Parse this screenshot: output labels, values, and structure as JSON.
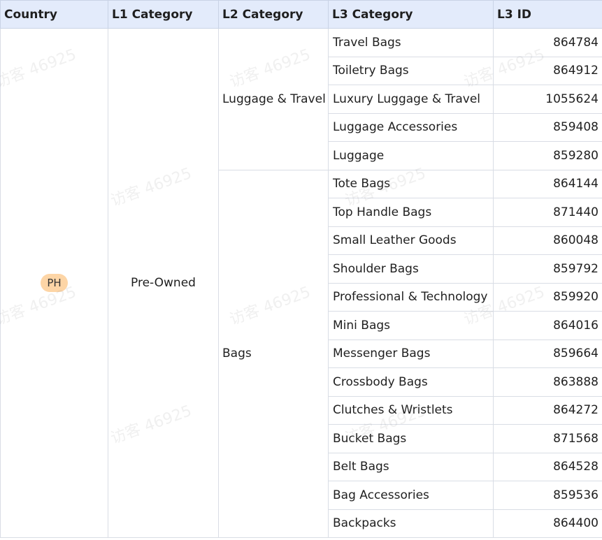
{
  "table": {
    "headers": [
      "Country",
      "L1 Category",
      "L2 Category",
      "L3 Category",
      "L3 ID"
    ],
    "country": "PH",
    "l1": "Pre-Owned",
    "groups": [
      {
        "l2": "Luggage & Travel",
        "rows": [
          {
            "l3": "Travel Bags",
            "id": "864784"
          },
          {
            "l3": "Toiletry Bags",
            "id": "864912"
          },
          {
            "l3": "Luxury Luggage & Travel",
            "id": "1055624"
          },
          {
            "l3": "Luggage Accessories",
            "id": "859408"
          },
          {
            "l3": "Luggage",
            "id": "859280"
          }
        ]
      },
      {
        "l2": "Bags",
        "rows": [
          {
            "l3": "Tote Bags",
            "id": "864144"
          },
          {
            "l3": "Top Handle Bags",
            "id": "871440"
          },
          {
            "l3": "Small Leather Goods",
            "id": "860048"
          },
          {
            "l3": "Shoulder Bags",
            "id": "859792"
          },
          {
            "l3": "Professional & Technology",
            "id": "859920"
          },
          {
            "l3": "Mini Bags",
            "id": "864016"
          },
          {
            "l3": "Messenger Bags",
            "id": "859664"
          },
          {
            "l3": "Crossbody Bags",
            "id": "863888"
          },
          {
            "l3": "Clutches & Wristlets",
            "id": "864272"
          },
          {
            "l3": "Bucket Bags",
            "id": "871568"
          },
          {
            "l3": "Belt Bags",
            "id": "864528"
          },
          {
            "l3": "Bag Accessories",
            "id": "859536"
          },
          {
            "l3": "Backpacks",
            "id": "864400"
          }
        ]
      }
    ]
  },
  "watermark": {
    "text": "访客 46925"
  },
  "colors": {
    "header_bg": "#e3ebfb",
    "badge_bg": "#fdd5a6",
    "border": "#d9dde5"
  }
}
